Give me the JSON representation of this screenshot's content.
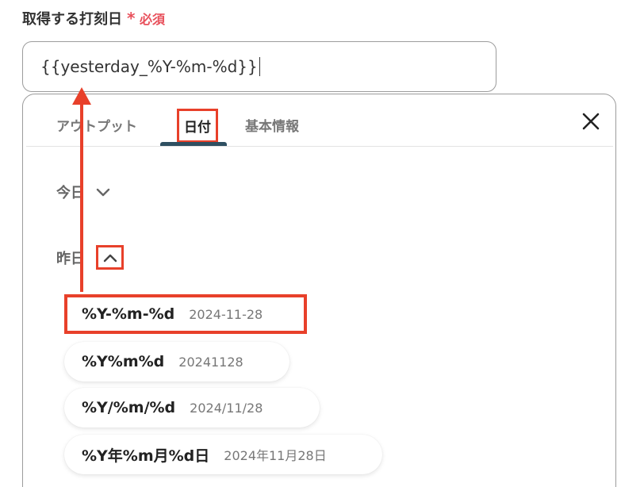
{
  "field": {
    "label": "取得する打刻日",
    "required_mark": "*",
    "required_text": "必須",
    "value": "{{yesterday_%Y-%m-%d}}"
  },
  "tabs": [
    {
      "label": "アウトプット",
      "active": false
    },
    {
      "label": "日付",
      "active": true
    },
    {
      "label": "基本情報",
      "active": false
    }
  ],
  "icons": {
    "close": "close-icon",
    "chevron_down": "chevron-down-icon",
    "chevron_up": "chevron-up-icon"
  },
  "groups": {
    "today": {
      "label": "今日",
      "expanded": false
    },
    "yesterday": {
      "label": "昨日",
      "expanded": true
    }
  },
  "options": [
    {
      "format": "%Y-%m-%d",
      "example": "2024-11-28"
    },
    {
      "format": "%Y%m%d",
      "example": "20241128"
    },
    {
      "format": "%Y/%m/%d",
      "example": "2024/11/28"
    },
    {
      "format": "%Y年%m月%d日",
      "example": "2024年11月28日"
    }
  ],
  "colors": {
    "highlight": "#e8402a",
    "required": "#e8505b",
    "tab_underline": "#2e4f61"
  }
}
